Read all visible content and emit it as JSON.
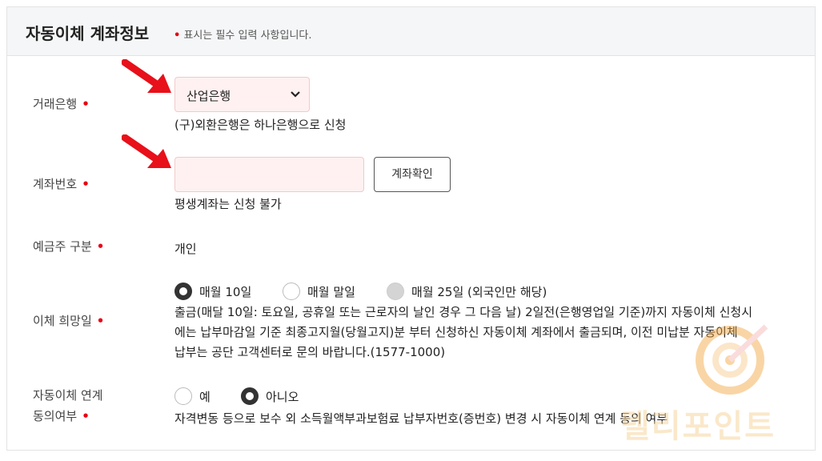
{
  "header": {
    "title": "자동이체 계좌정보",
    "required_dot": "•",
    "required_note": "표시는 필수 입력 사항입니다."
  },
  "fields": {
    "bank": {
      "label": "거래은행",
      "selected": "산업은행",
      "note": "(구)외환은행은 하나은행으로 신청"
    },
    "account": {
      "label": "계좌번호",
      "value": "",
      "button": "계좌확인",
      "note": "평생계좌는 신청 불가"
    },
    "holder_type": {
      "label": "예금주 구분",
      "value": "개인"
    },
    "transfer_day": {
      "label": "이체 희망일",
      "options": [
        {
          "label": "매월 10일",
          "state": "checked"
        },
        {
          "label": "매월 말일",
          "state": "unchecked"
        },
        {
          "label": "매월 25일 (외국인만 해당)",
          "state": "disabled"
        }
      ],
      "desc_lines": [
        "출금(매달 10일: 토요일, 공휴일 또는 근로자의 날인 경우 그 다음 날) 2일전(은행영업일 기준)까지 자동이체 신청시",
        "에는 납부마감일 기준 최종고지월(당월고지)분 부터 신청하신 자동이체 계좌에서 출금되며, 이전 미납분 자동이체",
        "납부는 공단 고객센터로 문의 바랍니다.(1577-1000)"
      ]
    },
    "consent": {
      "label_line1": "자동이체 연계",
      "label_line2": "동의여부",
      "options": [
        {
          "label": "예",
          "state": "unchecked"
        },
        {
          "label": "아니오",
          "state": "checked"
        }
      ],
      "desc": "자격변동 등으로 보수 외 소득월액부과보험료 납부자번호(증번호) 변경 시 자동이체 연계 동의 여부"
    }
  },
  "required_marker": "•",
  "watermark_text": "텔리포인트",
  "colors": {
    "required": "#e60012",
    "arrow": "#e8101a",
    "field_bg": "#fff1f1",
    "header_bg": "#f5f6f7"
  }
}
